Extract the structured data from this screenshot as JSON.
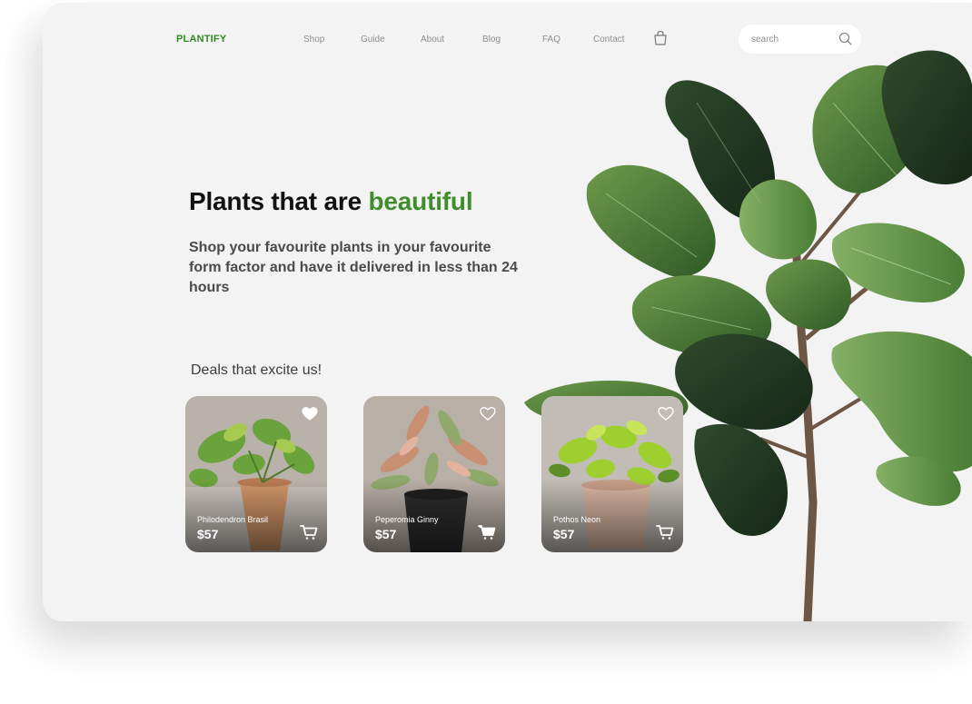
{
  "brand": {
    "logo": "PLANTIFY",
    "color": "#2f8a1f"
  },
  "nav": {
    "items": [
      {
        "label": "Shop"
      },
      {
        "label": "Guide"
      },
      {
        "label": "About"
      },
      {
        "label": "Blog"
      },
      {
        "label": "FAQ"
      },
      {
        "label": "Contact"
      }
    ],
    "bag_icon": "shopping-bag-icon"
  },
  "search": {
    "placeholder": "search",
    "value": "",
    "icon": "search-icon"
  },
  "hero": {
    "headline_prefix": "Plants that are ",
    "headline_accent": "beautiful",
    "accent_color": "#3e8e2b",
    "subheadline": "Shop your favourite plants in your favourite form factor and have it delivered in less than 24 hours"
  },
  "deals": {
    "title": "Deals that excite us!",
    "cards": [
      {
        "name": "Philodendron Brasil",
        "price": "$57",
        "favorited": true,
        "heart_icon": "heart-icon",
        "cart_icon": "cart-icon"
      },
      {
        "name": "Peperomia Ginny",
        "price": "$57",
        "favorited": false,
        "heart_icon": "heart-icon",
        "cart_icon": "cart-icon"
      },
      {
        "name": "Pothos Neon",
        "price": "$57",
        "favorited": false,
        "heart_icon": "heart-icon",
        "cart_icon": "cart-icon"
      }
    ]
  }
}
